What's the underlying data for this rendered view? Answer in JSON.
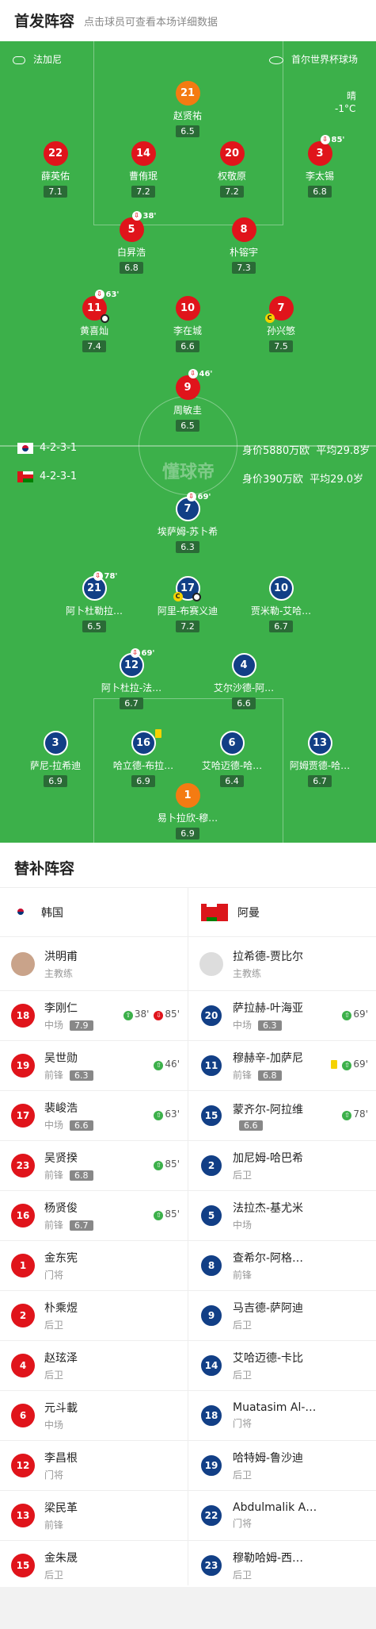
{
  "header": {
    "title": "首发阵容",
    "subtitle": "点击球员可查看本场详细数据"
  },
  "venue": {
    "referee": "法加尼",
    "stadium": "首尔世界杯球场",
    "weather": "晴",
    "temp": "-1°C"
  },
  "home": {
    "formation": "4-2-3-1",
    "value": "身价5880万欧",
    "age": "平均29.8岁"
  },
  "away": {
    "formation": "4-2-3-1",
    "value": "身价390万欧",
    "age": "平均29.0岁"
  },
  "watermark": "懂球帝",
  "home_players": [
    {
      "num": "21",
      "name": "赵贤祐",
      "rating": "6.5"
    },
    {
      "num": "22",
      "name": "薛英佑",
      "rating": "7.1"
    },
    {
      "num": "14",
      "name": "曹侑珉",
      "rating": "7.2"
    },
    {
      "num": "20",
      "name": "权敬原",
      "rating": "7.2"
    },
    {
      "num": "3",
      "name": "李太锡",
      "rating": "6.8",
      "sub": "85'"
    },
    {
      "num": "5",
      "name": "白昇浩",
      "rating": "6.8",
      "sub": "38'"
    },
    {
      "num": "8",
      "name": "朴镕宇",
      "rating": "7.3"
    },
    {
      "num": "11",
      "name": "黄喜灿",
      "rating": "7.4",
      "sub": "63'"
    },
    {
      "num": "10",
      "name": "李在城",
      "rating": "6.6"
    },
    {
      "num": "7",
      "name": "孙兴慜",
      "rating": "7.5"
    },
    {
      "num": "9",
      "name": "周敏圭",
      "rating": "6.5",
      "sub": "46'"
    }
  ],
  "away_players": [
    {
      "num": "7",
      "name": "埃萨姆-苏卜希",
      "rating": "6.3",
      "sub": "69'"
    },
    {
      "num": "21",
      "name": "阿卜杜勒拉…",
      "rating": "6.5",
      "sub": "78'"
    },
    {
      "num": "17",
      "name": "阿里-布赛义迪",
      "rating": "7.2"
    },
    {
      "num": "10",
      "name": "贾米勒-艾哈…",
      "rating": "6.7"
    },
    {
      "num": "12",
      "name": "阿卜杜拉-法…",
      "rating": "6.7",
      "sub": "69'"
    },
    {
      "num": "4",
      "name": "艾尔沙德-阿…",
      "rating": "6.6"
    },
    {
      "num": "3",
      "name": "萨尼-拉希迪",
      "rating": "6.9"
    },
    {
      "num": "16",
      "name": "哈立德-布拉…",
      "rating": "6.9"
    },
    {
      "num": "6",
      "name": "艾哈迈德-哈…",
      "rating": "6.4"
    },
    {
      "num": "13",
      "name": "阿姆贾德-哈…",
      "rating": "6.7"
    },
    {
      "num": "1",
      "name": "易卜拉欣-穆…",
      "rating": "6.9"
    }
  ],
  "subs": {
    "title": "替补阵容",
    "home": {
      "team": "韩国",
      "coach": "洪明甫",
      "coach_role": "主教练",
      "list": [
        {
          "num": "18",
          "name": "李刚仁",
          "pos": "中场",
          "rating": "7.9",
          "ev1": "38'",
          "ev2": "85'"
        },
        {
          "num": "19",
          "name": "吴世勋",
          "pos": "前锋",
          "rating": "6.3",
          "ev1": "46'"
        },
        {
          "num": "17",
          "name": "裴峻浩",
          "pos": "中场",
          "rating": "6.6",
          "ev1": "63'"
        },
        {
          "num": "23",
          "name": "吴贤揆",
          "pos": "前锋",
          "rating": "6.8",
          "ev1": "85'"
        },
        {
          "num": "16",
          "name": "杨贤俊",
          "pos": "前锋",
          "rating": "6.7",
          "ev1": "85'"
        },
        {
          "num": "1",
          "name": "金东宪",
          "pos": "门将"
        },
        {
          "num": "2",
          "name": "朴乘煜",
          "pos": "后卫"
        },
        {
          "num": "4",
          "name": "赵玹泽",
          "pos": "后卫"
        },
        {
          "num": "6",
          "name": "元斗載",
          "pos": "中场"
        },
        {
          "num": "12",
          "name": "李昌根",
          "pos": "门将"
        },
        {
          "num": "13",
          "name": "梁民革",
          "pos": "前锋"
        },
        {
          "num": "15",
          "name": "金朱晟",
          "pos": "后卫"
        }
      ]
    },
    "away": {
      "team": "阿曼",
      "coach": "拉希德-贾比尔",
      "coach_role": "主教练",
      "list": [
        {
          "num": "20",
          "name": "萨拉赫-叶海亚",
          "pos": "中场",
          "rating": "6.3",
          "ev1": "69'"
        },
        {
          "num": "11",
          "name": "穆赫辛-加萨尼",
          "pos": "前锋",
          "rating": "6.8",
          "ev1": "69'"
        },
        {
          "num": "15",
          "name": "蒙齐尔-阿拉维",
          "pos": "",
          "rating": "6.6",
          "ev1": "78'"
        },
        {
          "num": "2",
          "name": "加尼姆-哈巴希",
          "pos": "后卫"
        },
        {
          "num": "5",
          "name": "法拉杰-基尤米",
          "pos": "中场"
        },
        {
          "num": "8",
          "name": "查希尔-阿格…",
          "pos": "前锋"
        },
        {
          "num": "9",
          "name": "马吉德-萨阿迪",
          "pos": "后卫"
        },
        {
          "num": "14",
          "name": "艾哈迈德-卡比",
          "pos": "后卫"
        },
        {
          "num": "18",
          "name": "Muatasim Al-…",
          "pos": "门将"
        },
        {
          "num": "19",
          "name": "哈特姆-鲁沙迪",
          "pos": "后卫"
        },
        {
          "num": "22",
          "name": "Abdulmalik Al…",
          "pos": "门将"
        },
        {
          "num": "23",
          "name": "穆勒哈姆-西…",
          "pos": "后卫"
        }
      ]
    }
  }
}
